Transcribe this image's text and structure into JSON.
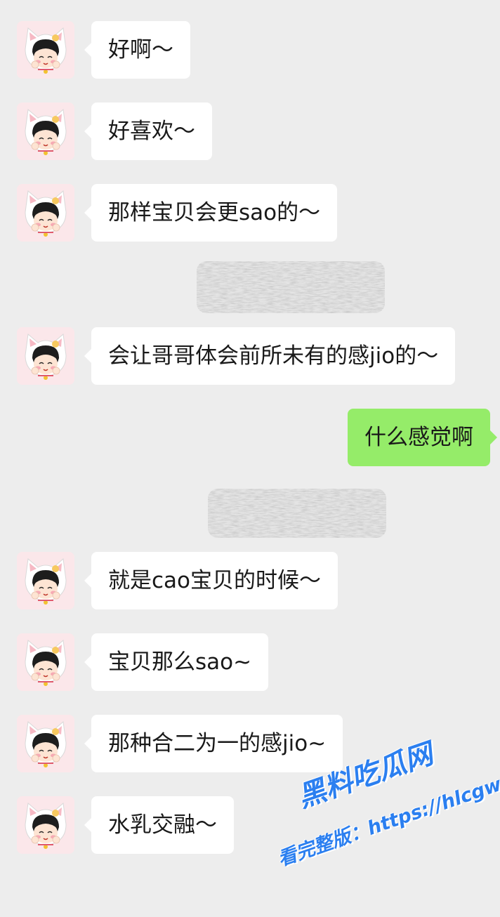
{
  "colors": {
    "background": "#ededed",
    "incoming_bubble": "#ffffff",
    "outgoing_bubble": "#95ec69",
    "text": "#191919",
    "watermark": "#2b7ff0"
  },
  "contact": {
    "avatar_icon": "cat-hat-girl-avatar-icon"
  },
  "messages": [
    {
      "direction": "incoming",
      "text": "好啊～"
    },
    {
      "direction": "incoming",
      "text": "好喜欢～"
    },
    {
      "direction": "incoming",
      "text": "那样宝贝会更sao的～"
    },
    {
      "direction": "incoming",
      "text": "会让哥哥体会前所未有的感jio的～"
    },
    {
      "direction": "outgoing",
      "text": "什么感觉啊"
    },
    {
      "direction": "incoming",
      "text": "就是cao宝贝的时候～"
    },
    {
      "direction": "incoming",
      "text": "宝贝那么sao~"
    },
    {
      "direction": "incoming",
      "text": "那种合二为一的感jio~"
    },
    {
      "direction": "incoming",
      "text": "水乳交融～"
    }
  ],
  "watermark": {
    "site_name": "黑料吃瓜网",
    "url_line": "看完整版：https://hlcgw.co"
  }
}
